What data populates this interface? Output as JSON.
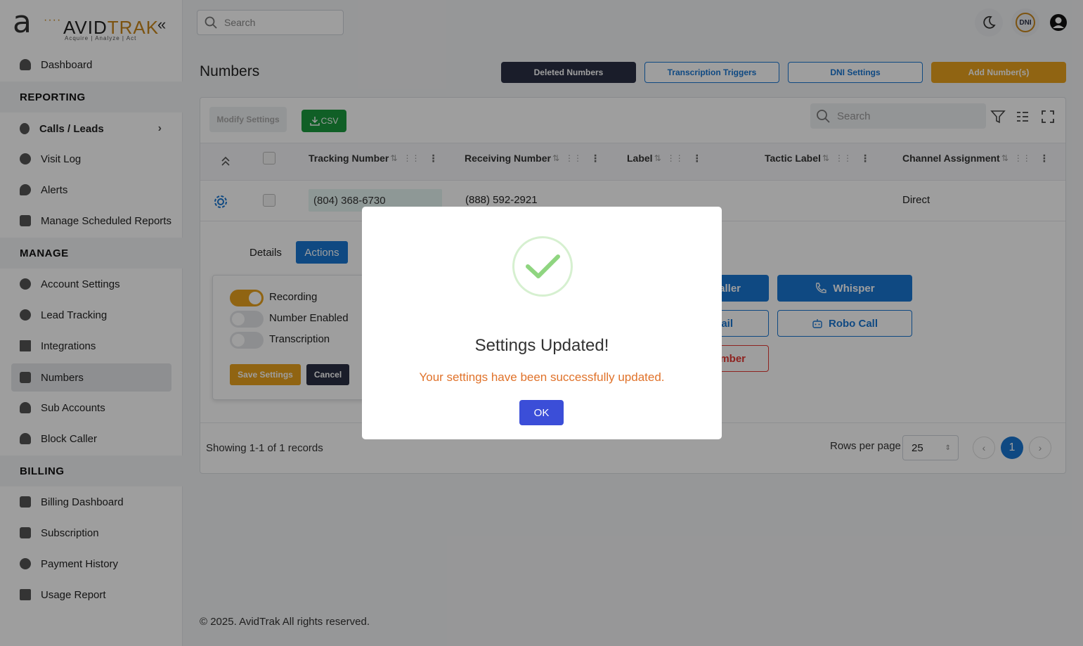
{
  "brand": {
    "name_left": "AVID",
    "name_right": "TRAK",
    "tagline": "Acquire | Analyze | Act"
  },
  "sidebar": {
    "items": [
      {
        "label": "Dashboard"
      },
      {
        "section": "REPORTING"
      },
      {
        "label": "Calls / Leads"
      },
      {
        "label": "Visit Log"
      },
      {
        "label": "Alerts"
      },
      {
        "label": "Manage Scheduled Reports"
      },
      {
        "section": "MANAGE"
      },
      {
        "label": "Account Settings"
      },
      {
        "label": "Lead Tracking"
      },
      {
        "label": "Integrations"
      },
      {
        "label": "Numbers"
      },
      {
        "label": "Sub Accounts"
      },
      {
        "label": "Block Caller"
      },
      {
        "section": "BILLING"
      },
      {
        "label": "Billing Dashboard"
      },
      {
        "label": "Subscription"
      },
      {
        "label": "Payment History"
      },
      {
        "label": "Usage Report"
      }
    ]
  },
  "topbar": {
    "search_placeholder": "Search",
    "dni_label": "DNI"
  },
  "header": {
    "title": "Numbers",
    "buttons": {
      "deleted": "Deleted Numbers",
      "transcription": "Transcription Triggers",
      "dni": "DNI Settings",
      "add": "Add Number(s)"
    }
  },
  "table": {
    "modify_settings": "Modify Settings",
    "csv": "CSV",
    "search_placeholder": "Search",
    "columns": {
      "tracking": "Tracking Number",
      "receiving": "Receiving Number",
      "label": "Label",
      "tactic": "Tactic Label",
      "channel": "Channel Assignment"
    },
    "row": {
      "tracking": "(804) 368-6730",
      "receiving": "(888) 592-2921",
      "label": "",
      "tactic": "",
      "channel": "Direct"
    },
    "detail": {
      "tabs": {
        "details": "Details",
        "actions": "Actions"
      },
      "toggles": {
        "recording": "Recording",
        "enabled": "Number Enabled",
        "transcription": "Transcription"
      },
      "save": "Save Settings",
      "cancel": "Cancel",
      "actions": {
        "caller_partial": "aller",
        "whisper": "Whisper",
        "email_partial": "ail",
        "robo": "Robo Call",
        "number_partial": "mber"
      }
    },
    "footer": {
      "showing": "Showing 1-1 of 1 records",
      "rows_per_page": "Rows per page",
      "rows_value": "25",
      "page": "1"
    }
  },
  "footer": {
    "copyright": "© 2025. AvidTrak All rights reserved."
  },
  "modal": {
    "title": "Settings Updated!",
    "message": "Your settings have been successfully updated.",
    "ok": "OK"
  },
  "colors": {
    "accent_orange": "#c8861a",
    "blue": "#1976d2",
    "dark": "#2b2f45",
    "green": "#1a8a3a",
    "modal_button": "#3b4ed8"
  }
}
